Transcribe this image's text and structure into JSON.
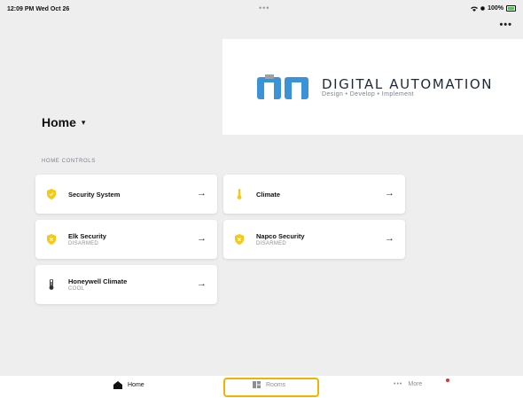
{
  "status_bar": {
    "time": "12:09 PM",
    "date": "Wed Oct 26",
    "battery": "100%"
  },
  "logo": {
    "title": "DIGITAL AUTOMATION",
    "subtitle": "Design • Develop • Implement"
  },
  "home": {
    "title": "Home",
    "section_label": "HOME CONTROLS"
  },
  "controls": [
    {
      "title": "Security System",
      "subtitle": "",
      "icon": "shield-icon"
    },
    {
      "title": "Climate",
      "subtitle": "",
      "icon": "thermometer-icon"
    },
    {
      "title": "Elk Security",
      "subtitle": "DISARMED",
      "icon": "shield-icon"
    },
    {
      "title": "Napco Security",
      "subtitle": "DISARMED",
      "icon": "shield-icon"
    },
    {
      "title": "Honeywell Climate",
      "subtitle": "COOL",
      "icon": "thermometer-icon"
    }
  ],
  "tabs": [
    {
      "label": "Home",
      "icon": "house-icon"
    },
    {
      "label": "Rooms",
      "icon": "rooms-icon"
    },
    {
      "label": "More",
      "icon": "ellipsis-icon"
    }
  ],
  "colors": {
    "accent": "#f0b400",
    "shield": "#f6c915",
    "notification": "#e53030"
  }
}
